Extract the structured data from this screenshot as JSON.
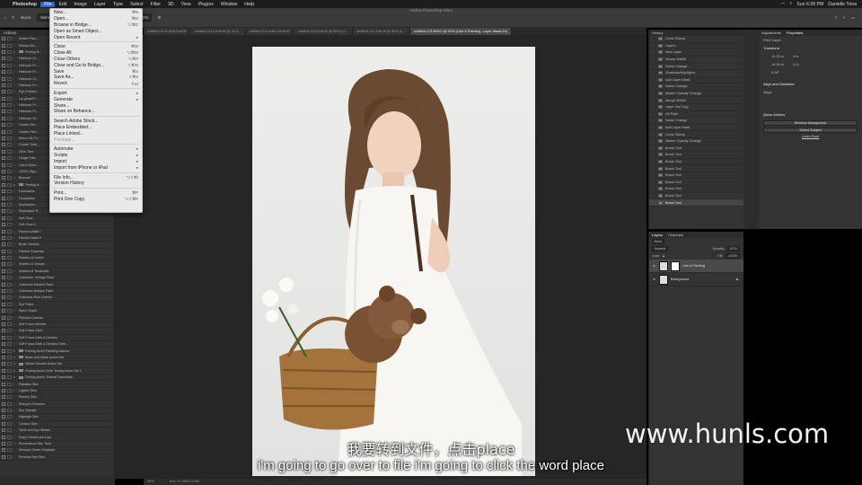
{
  "menubar": {
    "items": [
      "Photoshop",
      "File",
      "Edit",
      "Image",
      "Layer",
      "Type",
      "Select",
      "Filter",
      "3D",
      "View",
      "Plugins",
      "Window",
      "Help"
    ],
    "clock": "Sun 6:39 PM",
    "user": "Danielle Trina"
  },
  "window_title": "Adobe Photoshop 2021",
  "options_bar": {
    "mode_label": "Mode:",
    "mode_value": "Normal",
    "flow_label": "Flow:",
    "flow_value": "100%",
    "smoothing_label": "Smoothing:",
    "smoothing_value": "10%"
  },
  "tabs": [
    {
      "label": "untitled-1112-Edit-Edit.tif"
    },
    {
      "label": "untitled-1112-Edit.tif @ 33.3..."
    },
    {
      "label": "untitled-910-edit-2-Edit.tif"
    },
    {
      "label": "untitled-123-Edit.tif @ 50% (Li..."
    },
    {
      "label": "untitled-111-Edit.tif @ 50% (L..."
    },
    {
      "label": "untitled-12126NG @ 50% (Like A Painting, Layer Mask/16)"
    }
  ],
  "file_menu": {
    "groups": [
      [
        {
          "label": "New...",
          "sc": "⌘N"
        },
        {
          "label": "Open...",
          "sc": "⌘O"
        },
        {
          "label": "Browse in Bridge...",
          "sc": "⌥⌘O"
        },
        {
          "label": "Open as Smart Object...",
          "sc": ""
        },
        {
          "label": "Open Recent",
          "sc": "▸"
        }
      ],
      [
        {
          "label": "Close",
          "sc": "⌘W"
        },
        {
          "label": "Close All",
          "sc": "⌥⌘W"
        },
        {
          "label": "Close Others",
          "sc": "⌥⌘P"
        },
        {
          "label": "Close and Go to Bridge...",
          "sc": "⇧⌘W"
        },
        {
          "label": "Save",
          "sc": "⌘S"
        },
        {
          "label": "Save As...",
          "sc": "⇧⌘S"
        },
        {
          "label": "Revert",
          "sc": "F12"
        }
      ],
      [
        {
          "label": "Export",
          "sc": "▸"
        },
        {
          "label": "Generate",
          "sc": "▸"
        },
        {
          "label": "Share...",
          "sc": ""
        },
        {
          "label": "Share on Behance...",
          "sc": ""
        }
      ],
      [
        {
          "label": "Search Adobe Stock...",
          "sc": ""
        },
        {
          "label": "Place Embedded...",
          "sc": ""
        },
        {
          "label": "Place Linked...",
          "sc": ""
        },
        {
          "label": "Package...",
          "sc": "",
          "disabled": true
        }
      ],
      [
        {
          "label": "Automate",
          "sc": "▸"
        },
        {
          "label": "Scripts",
          "sc": "▸"
        },
        {
          "label": "Import",
          "sc": "▸"
        },
        {
          "label": "Import from iPhone or iPad",
          "sc": "▸"
        }
      ],
      [
        {
          "label": "File Info...",
          "sc": "⌥⇧⌘I"
        },
        {
          "label": "Version History",
          "sc": ""
        }
      ],
      [
        {
          "label": "Print...",
          "sc": "⌘P"
        },
        {
          "label": "Print One Copy",
          "sc": "⌥⇧⌘P"
        }
      ]
    ]
  },
  "actions_panel": {
    "title": "Actions",
    "rows": [
      {
        "label": "Artistic Pain...",
        "folder": false
      },
      {
        "label": "Mellow Wo...",
        "folder": false
      },
      {
        "label": "Finding N...",
        "folder": true
      },
      {
        "label": "Heirloom Cr...",
        "folder": false
      },
      {
        "label": "Heirloom Pr...",
        "folder": false
      },
      {
        "label": "Heirloom Pr...",
        "folder": false
      },
      {
        "label": "Heirloom Cr...",
        "folder": false
      },
      {
        "label": "Heirloom Pr...",
        "folder": false
      },
      {
        "label": "Eye Enhanc...",
        "folder": false
      },
      {
        "label": "Lip gloss/Pr...",
        "folder": false
      },
      {
        "label": "Heirloom Pr...",
        "folder": false
      },
      {
        "label": "Heirloom Pr...",
        "folder": false
      },
      {
        "label": "Heirloom Gr...",
        "folder": false
      },
      {
        "label": "Golden Shi...",
        "folder": false
      },
      {
        "label": "Golden Film...",
        "folder": false
      },
      {
        "label": "Mono Lite Tri...",
        "folder": false
      },
      {
        "label": "Cookie Tone...",
        "folder": false
      },
      {
        "label": "Olive Tree",
        "folder": false
      },
      {
        "label": "Ginger Film",
        "folder": false
      },
      {
        "label": "Like A Paint...",
        "folder": false
      },
      {
        "label": "1920's Vign...",
        "folder": false
      },
      {
        "label": "Bhavani",
        "folder": false
      },
      {
        "label": "Finding N...",
        "folder": true
      },
      {
        "label": "Foundation",
        "folder": false
      },
      {
        "label": "Foundation",
        "folder": false
      },
      {
        "label": "Emphasize...",
        "folder": false
      },
      {
        "label": "Emphasize R...",
        "folder": false
      },
      {
        "label": "Soft Glow",
        "folder": false
      },
      {
        "label": "Soft Glow II",
        "folder": false
      },
      {
        "label": "Painted Matte I",
        "folder": false
      },
      {
        "label": "Painted Matte II",
        "folder": false
      },
      {
        "label": "Brush Strokes",
        "folder": false
      },
      {
        "label": "Painted Shadows",
        "folder": false
      },
      {
        "label": "Shades of Umber",
        "folder": false
      },
      {
        "label": "Shades of Jumper",
        "folder": false
      },
      {
        "label": "Shades of Terracotta",
        "folder": false
      },
      {
        "label": "Colortone- Vintage Paint",
        "folder": false
      },
      {
        "label": "Colortone-Modern Paint",
        "folder": false
      },
      {
        "label": "Colortone-Antique Paint",
        "folder": false
      },
      {
        "label": "Colortone-Rich Greens",
        "folder": false
      },
      {
        "label": "Eye Shine",
        "folder": false
      },
      {
        "label": "Warm Depth",
        "folder": false
      },
      {
        "label": "Polished Canvas",
        "folder": false
      },
      {
        "label": "Soft Focus-Neutral",
        "folder": false
      },
      {
        "label": "Soft Focus-Vivid",
        "folder": false
      },
      {
        "label": "Soft Focus-Dark & Dreams",
        "folder": false
      },
      {
        "label": "Soft Focus-Dark & Dreams Gree...",
        "folder": false
      },
      {
        "label": "Finding North Painterly Actions",
        "folder": true
      },
      {
        "label": "Black and White Action Set",
        "folder": true
      },
      {
        "label": "Winter Wonder Action Set",
        "folder": true
      },
      {
        "label": "Finding North Color Toning Action Set 1",
        "folder": true
      },
      {
        "label": "Finding North- Portrait Essentials",
        "folder": true
      },
      {
        "label": "Flawless Skin",
        "folder": false
      },
      {
        "label": "Lighten Skin",
        "folder": false
      },
      {
        "label": "Peachy Skin",
        "folder": false
      },
      {
        "label": "Sharpen Features",
        "folder": false
      },
      {
        "label": "Eye Sparkle",
        "folder": false
      },
      {
        "label": "Highlight Skin",
        "folder": false
      },
      {
        "label": "Contour Skin",
        "folder": false
      },
      {
        "label": "Teeth and Eye Whiten",
        "folder": false
      },
      {
        "label": "Rosy Cheeks and Lips",
        "folder": false
      },
      {
        "label": "Reconstruct Skin Tone",
        "folder": false
      },
      {
        "label": "Remove Green Shadows",
        "folder": false
      },
      {
        "label": "Remove Red Skin",
        "folder": false
      }
    ]
  },
  "history_panel": {
    "title": "History",
    "rows": [
      "Clone Stamp",
      "Layers",
      "New Layer",
      "Stamp Visible",
      "Name Change",
      "Shadows/Highlights",
      "Add Layer Mask",
      "Name Change",
      "Master Opacity Change",
      "Merge Visible",
      "Layer Via Copy",
      "Oil Paint",
      "Name Change",
      "Add Layer Mask",
      "Clone Stamp",
      "Master Opacity Change",
      "Brush Tool",
      "Brush Tool",
      "Brush Tool",
      "Brush Tool",
      "Brush Tool",
      "Brush Tool",
      "Brush Tool",
      "Brush Tool",
      "Brush Tool"
    ]
  },
  "properties_panel": {
    "tabs": [
      "Adjustments",
      "Properties"
    ],
    "layer_type": "Pixel Layer",
    "transform_label": "Transform",
    "w_value": "11.33 in",
    "h_value": "16.84 in",
    "x_value": "0 in",
    "y_value": "0 in",
    "angle_value": "0.00°",
    "align_label": "Align and Distribute",
    "align_sub": "Align:",
    "quick_actions_label": "Quick Actions",
    "remove_bg": "Remove Background",
    "select_subject": "Select Subject",
    "learn_more": "Learn More"
  },
  "layers_panel": {
    "tabs": [
      "Layers",
      "Channels"
    ],
    "kind": "Kind",
    "blend": "Normal",
    "opacity_label": "Opacity:",
    "opacity_value": "67%",
    "lock_label": "Lock:",
    "fill_label": "Fill:",
    "fill_value": "100%",
    "layers": [
      {
        "name": "Like A Painting",
        "selected": true
      },
      {
        "name": "Background",
        "selected": false
      }
    ]
  },
  "status": {
    "zoom": "50%",
    "doc": "Doc: 97.4M/272.8M"
  },
  "subtitles": {
    "zh": "我要转到文件，点击place",
    "en": "i'm going to go over to file i'm going to click the word place"
  },
  "watermark": "www.hunls.com",
  "colors": {
    "menu_highlight": "#2f66d9",
    "panel_bg": "#333333",
    "canvas_bg": "#262626"
  }
}
